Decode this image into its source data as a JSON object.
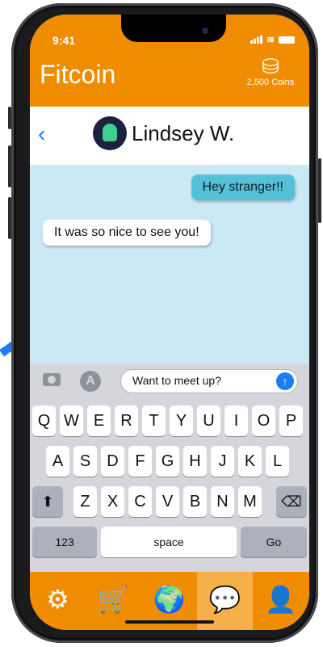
{
  "status": {
    "time": "9:41"
  },
  "app": {
    "title": "Fitcoin",
    "coins_label": "2,500 Coins"
  },
  "chat": {
    "back_icon": "chevron-left",
    "contact_name": "Lindsey W.",
    "messages": [
      {
        "direction": "outgoing",
        "text": "Hey stranger!!"
      },
      {
        "direction": "incoming",
        "text": "It was so nice to see you!"
      }
    ]
  },
  "composer": {
    "value": "Want to meet up?",
    "send_icon": "↑"
  },
  "keyboard": {
    "row1": [
      "Q",
      "W",
      "E",
      "R",
      "T",
      "Y",
      "U",
      "I",
      "O",
      "P"
    ],
    "row2": [
      "A",
      "S",
      "D",
      "F",
      "G",
      "H",
      "J",
      "K",
      "L"
    ],
    "row3": [
      "Z",
      "X",
      "C",
      "V",
      "B",
      "N",
      "M"
    ],
    "shift": "⬆",
    "delete": "⌫",
    "numbers": "123",
    "space": "space",
    "go": "Go"
  },
  "tabs": [
    {
      "icon": "gear-icon",
      "glyph": "⚙"
    },
    {
      "icon": "cart-icon",
      "glyph": "🛒"
    },
    {
      "icon": "globe-icon",
      "glyph": "🌍"
    },
    {
      "icon": "chat-icon",
      "glyph": "💬",
      "active": true
    },
    {
      "icon": "profile-icon",
      "glyph": "👤"
    }
  ],
  "colors": {
    "brand": "#f08c00",
    "chat_bg": "#cbe8f5",
    "outgoing_bubble": "#55c1d8",
    "accent": "#1e7cf2"
  }
}
